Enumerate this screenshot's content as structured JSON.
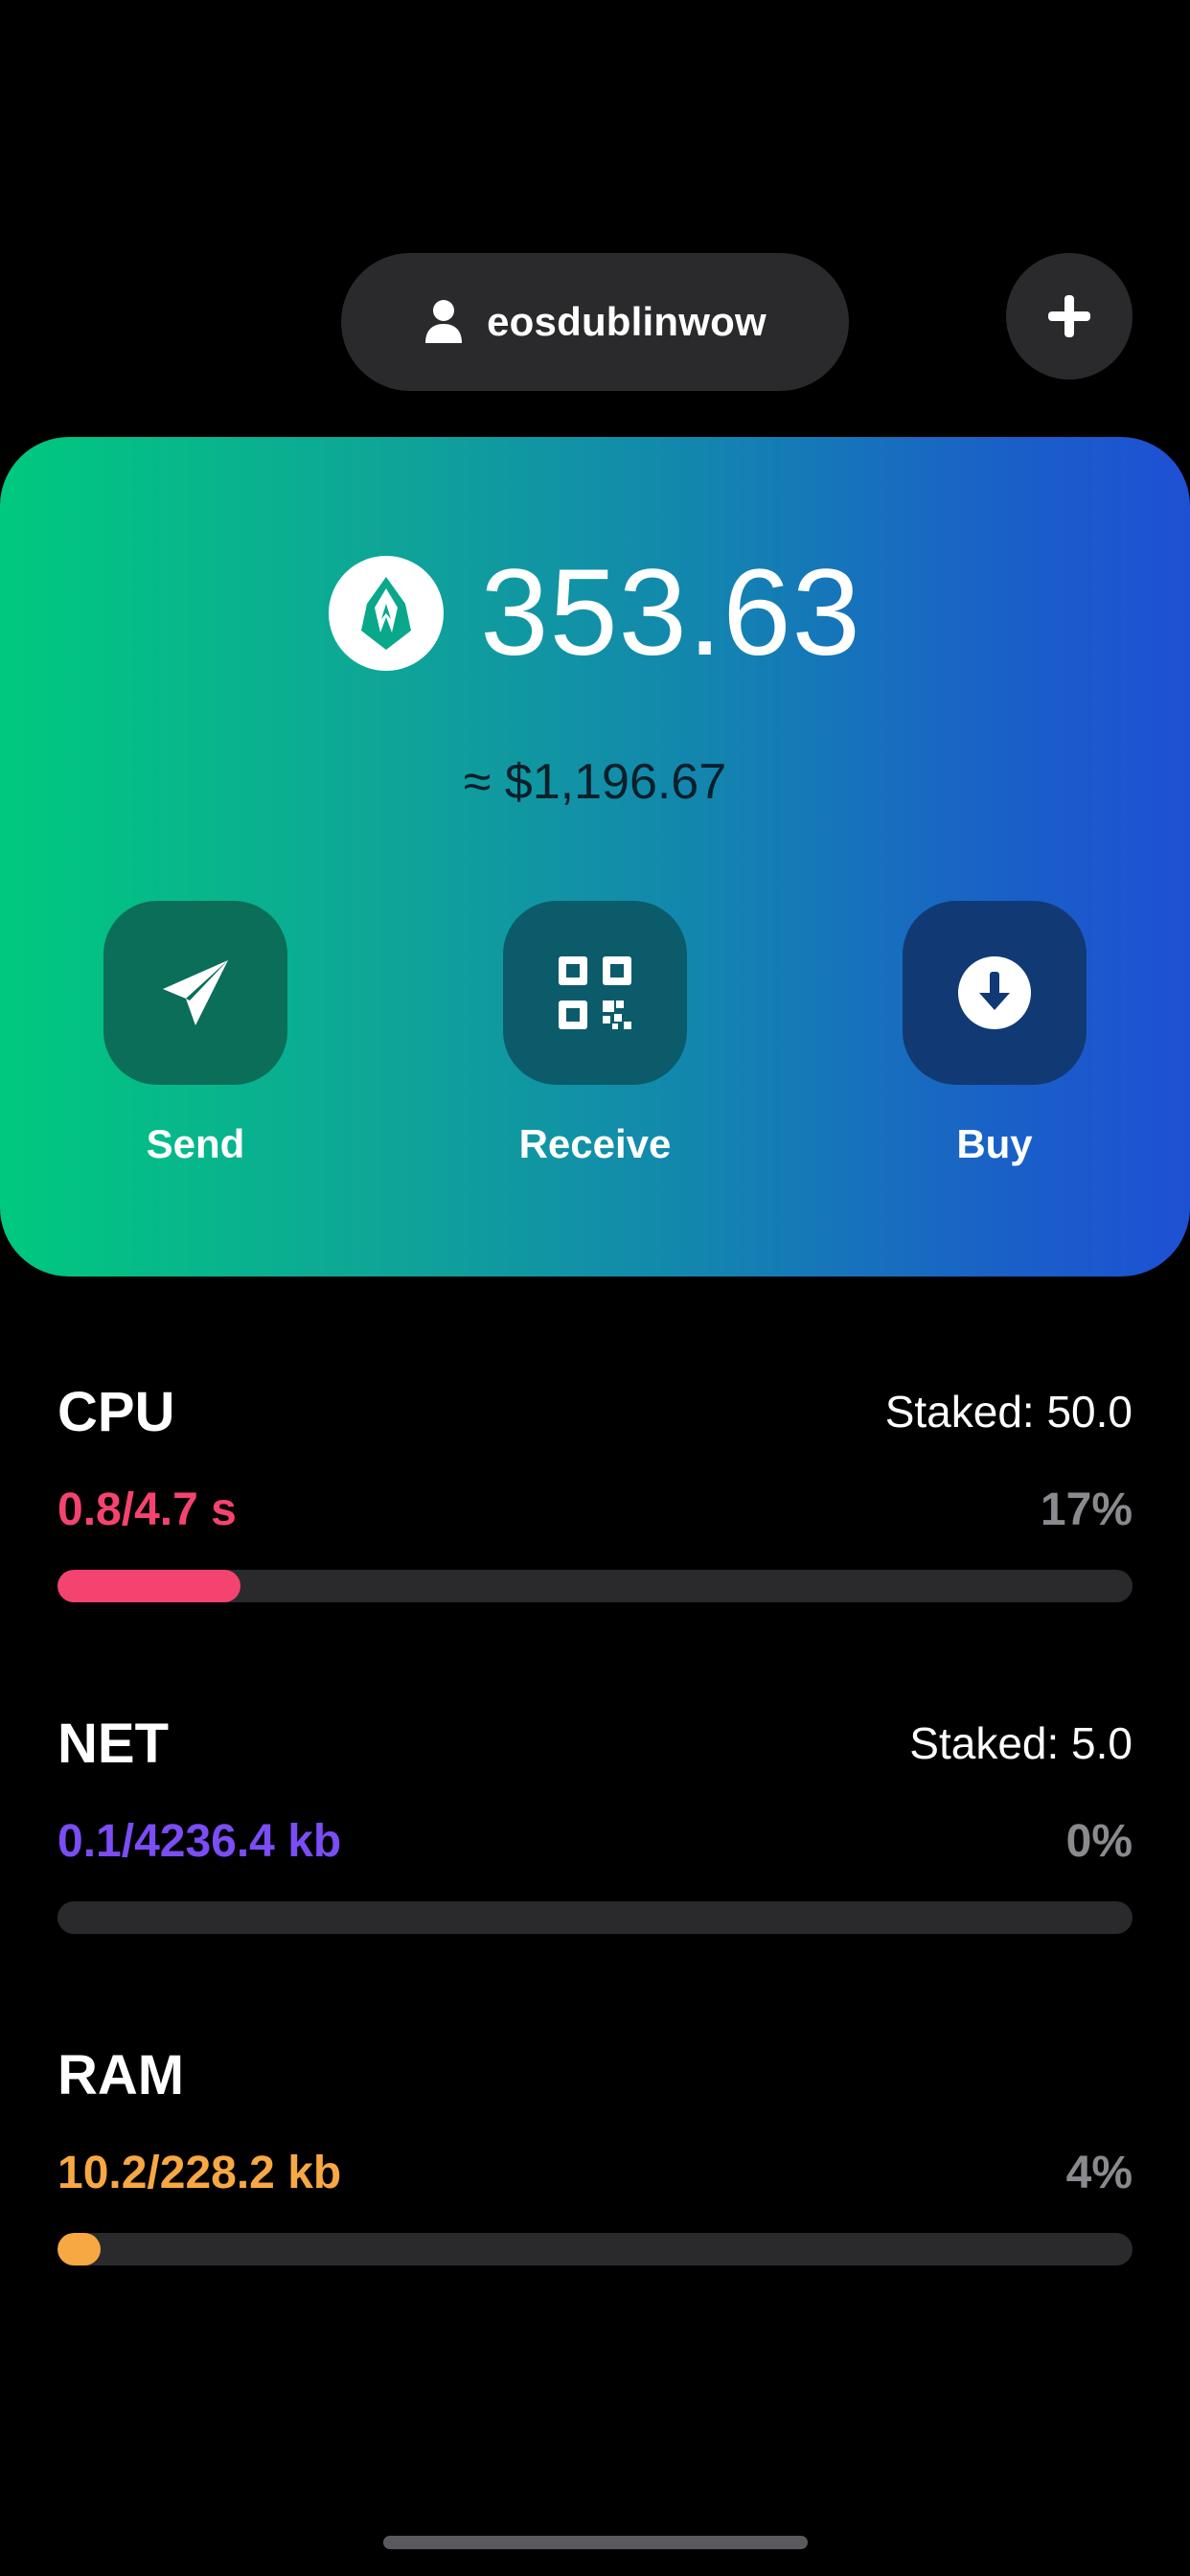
{
  "header": {
    "account_name": "eosdublinwow",
    "user_icon": "person-icon",
    "add_icon": "plus-icon"
  },
  "balance": {
    "amount": "353.63",
    "fiat": "≈ $1,196.67",
    "token_icon": "eos-token-icon"
  },
  "actions": [
    {
      "label": "Send",
      "icon": "paper-plane-icon"
    },
    {
      "label": "Receive",
      "icon": "qr-code-icon"
    },
    {
      "label": "Buy",
      "icon": "download-arrow-icon"
    }
  ],
  "resources": {
    "cpu": {
      "name": "CPU",
      "staked": "Staked: 50.0",
      "usage": "0.8/4.7 s",
      "percent": "17%",
      "fraction": 0.17,
      "color": "#f5436f"
    },
    "net": {
      "name": "NET",
      "staked": "Staked: 5.0",
      "usage": "0.1/4236.4 kb",
      "percent": "0%",
      "fraction": 0.0,
      "color": "#7a4df5"
    },
    "ram": {
      "name": "RAM",
      "usage": "10.2/228.2 kb",
      "percent": "4%",
      "fraction": 0.04,
      "color": "#f7a842"
    }
  },
  "colors": {
    "background": "#000000",
    "surface": "#2a2a2c",
    "card_gradient_start": "#00c97e",
    "card_gradient_end": "#1e50d4"
  }
}
